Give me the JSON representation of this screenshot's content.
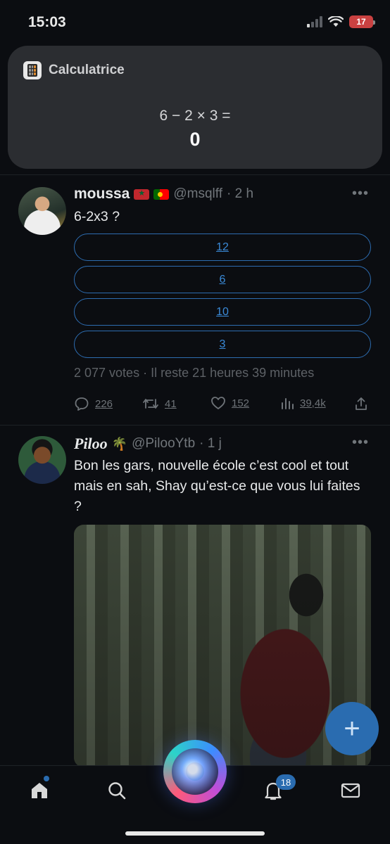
{
  "status_bar": {
    "time": "15:03",
    "battery": "17"
  },
  "siri_calc": {
    "app_name": "Calculatrice",
    "expression": "6 − 2 × 3 =",
    "result": "0"
  },
  "tweets": [
    {
      "display_name": "moussa",
      "handle": "@msqlff",
      "time": "· 2 h",
      "text": "6-2x3 ?",
      "poll": {
        "options": [
          "12",
          "6",
          "10",
          "3"
        ],
        "meta": "2 077 votes · Il reste 21 heures 39 minutes"
      },
      "actions": {
        "replies": "226",
        "retweets": "41",
        "likes": "152",
        "views": "39,4k"
      }
    },
    {
      "display_name": "Piloo",
      "handle": "@PilooYtb",
      "time": "· 1 j",
      "text": "Bon les gars, nouvelle école c’est cool et tout mais en sah, Shay qu’est-ce que vous lui faites ?"
    }
  ],
  "tab_bar": {
    "notifications_badge": "18"
  },
  "colors": {
    "accent": "#2a6cb0",
    "background": "#0b0d11",
    "card": "#2b2d31",
    "battery": "#c94141"
  }
}
